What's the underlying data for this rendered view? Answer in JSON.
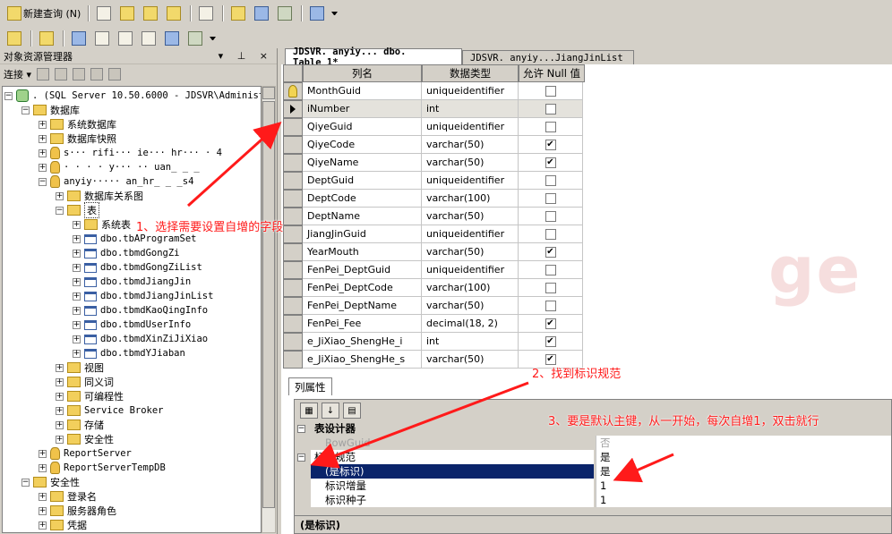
{
  "toolbar1": {
    "new_query": "新建查询 (N)"
  },
  "object_explorer": {
    "title": "对象资源管理器",
    "title_controls": "▾ ⊥ ×",
    "connect": "连接",
    "tree": [
      {
        "id": "server",
        "label": ". (SQL Server 10.50.6000 - JDSVR\\Administr",
        "expander": "−",
        "icon": "server",
        "mono": true
      },
      {
        "id": "databases",
        "label": "数据库",
        "expander": "−",
        "icon": "folder"
      },
      {
        "id": "sysdb",
        "label": "系统数据库",
        "expander": "+",
        "icon": "folder"
      },
      {
        "id": "snapshots",
        "label": "数据库快照",
        "expander": "+",
        "icon": "folder"
      },
      {
        "id": "db1",
        "label": "s··· rifi··· ie··· hr··· · 4",
        "expander": "+",
        "icon": "db",
        "mono": true
      },
      {
        "id": "db2",
        "label": "· · · · y··· ·· uan_ _ _",
        "expander": "+",
        "icon": "db",
        "mono": true
      },
      {
        "id": "db3",
        "label": "anyiy····· an_hr_ _ _s4",
        "expander": "−",
        "icon": "db",
        "mono": true
      },
      {
        "id": "diagrams",
        "label": "数据库关系图",
        "expander": "+",
        "icon": "folder"
      },
      {
        "id": "tables",
        "label": "表",
        "expander": "−",
        "icon": "folder",
        "selected": true
      },
      {
        "id": "systables",
        "label": "系统表",
        "expander": "+",
        "icon": "folder"
      },
      {
        "id": "t1",
        "label": "dbo.tbAProgramSet",
        "expander": "+",
        "icon": "table",
        "mono": true
      },
      {
        "id": "t2",
        "label": "dbo.tbmdGongZi",
        "expander": "+",
        "icon": "table",
        "mono": true
      },
      {
        "id": "t3",
        "label": "dbo.tbmdGongZiList",
        "expander": "+",
        "icon": "table",
        "mono": true
      },
      {
        "id": "t4",
        "label": "dbo.tbmdJiangJin",
        "expander": "+",
        "icon": "table",
        "mono": true
      },
      {
        "id": "t5",
        "label": "dbo.tbmdJiangJinList",
        "expander": "+",
        "icon": "table",
        "mono": true
      },
      {
        "id": "t6",
        "label": "dbo.tbmdKaoQingInfo",
        "expander": "+",
        "icon": "table",
        "mono": true
      },
      {
        "id": "t7",
        "label": "dbo.tbmdUserInfo",
        "expander": "+",
        "icon": "table",
        "mono": true
      },
      {
        "id": "t8",
        "label": "dbo.tbmdXinZiJiXiao",
        "expander": "+",
        "icon": "table",
        "mono": true
      },
      {
        "id": "t9",
        "label": "dbo.tbmdYJiaban",
        "expander": "+",
        "icon": "table",
        "mono": true
      },
      {
        "id": "views",
        "label": "视图",
        "expander": "+",
        "icon": "folder"
      },
      {
        "id": "synonyms",
        "label": "同义词",
        "expander": "+",
        "icon": "folder"
      },
      {
        "id": "programmability",
        "label": "可编程性",
        "expander": "+",
        "icon": "folder"
      },
      {
        "id": "broker",
        "label": "Service Broker",
        "expander": "+",
        "icon": "folder",
        "mono": true
      },
      {
        "id": "storage",
        "label": "存储",
        "expander": "+",
        "icon": "folder"
      },
      {
        "id": "security_db",
        "label": "安全性",
        "expander": "+",
        "icon": "folder"
      },
      {
        "id": "rs",
        "label": "ReportServer",
        "expander": "+",
        "icon": "db",
        "mono": true
      },
      {
        "id": "rstemp",
        "label": "ReportServerTempDB",
        "expander": "+",
        "icon": "db",
        "mono": true
      },
      {
        "id": "security",
        "label": "安全性",
        "expander": "−",
        "icon": "folder"
      },
      {
        "id": "logins",
        "label": "登录名",
        "expander": "+",
        "icon": "folder"
      },
      {
        "id": "roles",
        "label": "服务器角色",
        "expander": "+",
        "icon": "folder"
      },
      {
        "id": "creds",
        "label": "凭据",
        "expander": "+",
        "icon": "folder"
      }
    ]
  },
  "tabs": [
    {
      "label": "JDSVR. anyiy... dbo. Table_1*",
      "active": true
    },
    {
      "label": "JDSVR. anyiy...JiangJinList",
      "active": false
    }
  ],
  "designer": {
    "headers": {
      "name": "列名",
      "type": "数据类型",
      "null": "允许 Null 值"
    },
    "rows": [
      {
        "name": "MonthGuid",
        "type": "uniqueidentifier",
        "nullable": false,
        "marker": "key"
      },
      {
        "name": "iNumber",
        "type": "int",
        "nullable": false,
        "marker": "pointer",
        "highlight": true
      },
      {
        "name": "QiyeGuid",
        "type": "uniqueidentifier",
        "nullable": false
      },
      {
        "name": "QiyeCode",
        "type": "varchar(50)",
        "nullable": true
      },
      {
        "name": "QiyeName",
        "type": "varchar(50)",
        "nullable": true
      },
      {
        "name": "DeptGuid",
        "type": "uniqueidentifier",
        "nullable": false
      },
      {
        "name": "DeptCode",
        "type": "varchar(100)",
        "nullable": false
      },
      {
        "name": "DeptName",
        "type": "varchar(50)",
        "nullable": false
      },
      {
        "name": "JiangJinGuid",
        "type": "uniqueidentifier",
        "nullable": false
      },
      {
        "name": "YearMouth",
        "type": "varchar(50)",
        "nullable": true
      },
      {
        "name": "FenPei_DeptGuid",
        "type": "uniqueidentifier",
        "nullable": false
      },
      {
        "name": "FenPei_DeptCode",
        "type": "varchar(100)",
        "nullable": false
      },
      {
        "name": "FenPei_DeptName",
        "type": "varchar(50)",
        "nullable": false
      },
      {
        "name": "FenPei_Fee",
        "type": "decimal(18, 2)",
        "nullable": true
      },
      {
        "name": "e_JiXiao_ShengHe_i",
        "type": "int",
        "nullable": true
      },
      {
        "name": "e_JiXiao_ShengHe_s",
        "type": "varchar(50)",
        "nullable": true
      }
    ],
    "watermark": "ge"
  },
  "properties": {
    "tab_label": "列属性",
    "rows": [
      {
        "label": "表设计器",
        "value": "",
        "category": true,
        "expander": "−"
      },
      {
        "label": "RowGuid",
        "value": "否",
        "grey": true
      },
      {
        "label": "标识规范",
        "value": "是",
        "expander": "−",
        "white": true
      },
      {
        "label": "(是标识)",
        "value": "是",
        "highlight": true
      },
      {
        "label": "标识增量",
        "value": "1",
        "white": true
      },
      {
        "label": "标识种子",
        "value": "1",
        "white": true
      }
    ],
    "description": "(是标识)"
  },
  "annotations": {
    "step1": "1、选择需要设置自增的字段",
    "step2": "2、找到标识规范",
    "step3": "3、要是默认主键，从一开始，每次自增1，双击就行",
    "color": "#ff1a1a"
  }
}
